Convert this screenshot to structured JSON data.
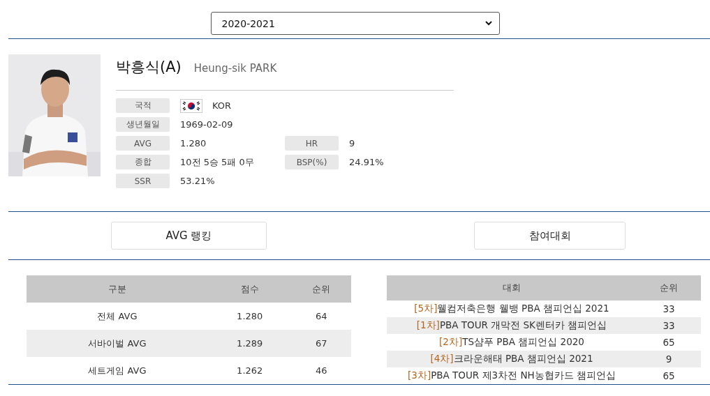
{
  "season_select": {
    "value": "2020-2021"
  },
  "player": {
    "name": "박흥식(A)",
    "name_en": "Heung-sik PARK",
    "info_rows": [
      {
        "label": "국적",
        "value": "KOR",
        "kind": "flag"
      },
      {
        "label": "생년월일",
        "value": "1969-02-09",
        "kind": "plain"
      },
      {
        "label": "AVG",
        "value": "1.280",
        "kind": "plain",
        "label2": "HR",
        "value2": "9"
      },
      {
        "label": "종합",
        "value": "10전 5승 5패 0무",
        "kind": "plain",
        "label2": "BSP(%)",
        "value2": "24.91%"
      },
      {
        "label": "SSR",
        "value": "53.21%",
        "kind": "plain"
      }
    ]
  },
  "section_buttons": [
    "AVG 랭킹",
    "참여대회"
  ],
  "avg_table": {
    "columns": [
      "구분",
      "점수",
      "순위"
    ],
    "rows": [
      [
        "전체 AVG",
        "1.280",
        "64"
      ],
      [
        "서바이벌 AVG",
        "1.289",
        "67"
      ],
      [
        "세트게임 AVG",
        "1.262",
        "46"
      ]
    ]
  },
  "tournament_table": {
    "columns": [
      "대회",
      "순위"
    ],
    "rows": [
      {
        "round": "[5차]",
        "title": "웰컴저축은행 웰뱅 PBA 챔피언십 2021",
        "rank": "33"
      },
      {
        "round": "[1차]",
        "title": "PBA TOUR 개막전 SK렌터카 챔피언십",
        "rank": "33"
      },
      {
        "round": "[2차]",
        "title": "TS샴푸 PBA 챔피언십 2020",
        "rank": "65"
      },
      {
        "round": "[4차]",
        "title": "크라운해태 PBA 챔피언십 2021",
        "rank": "9"
      },
      {
        "round": "[3차]",
        "title": "PBA TOUR 제3차전 NH농협카드 챔피언십",
        "rank": "65"
      }
    ]
  }
}
